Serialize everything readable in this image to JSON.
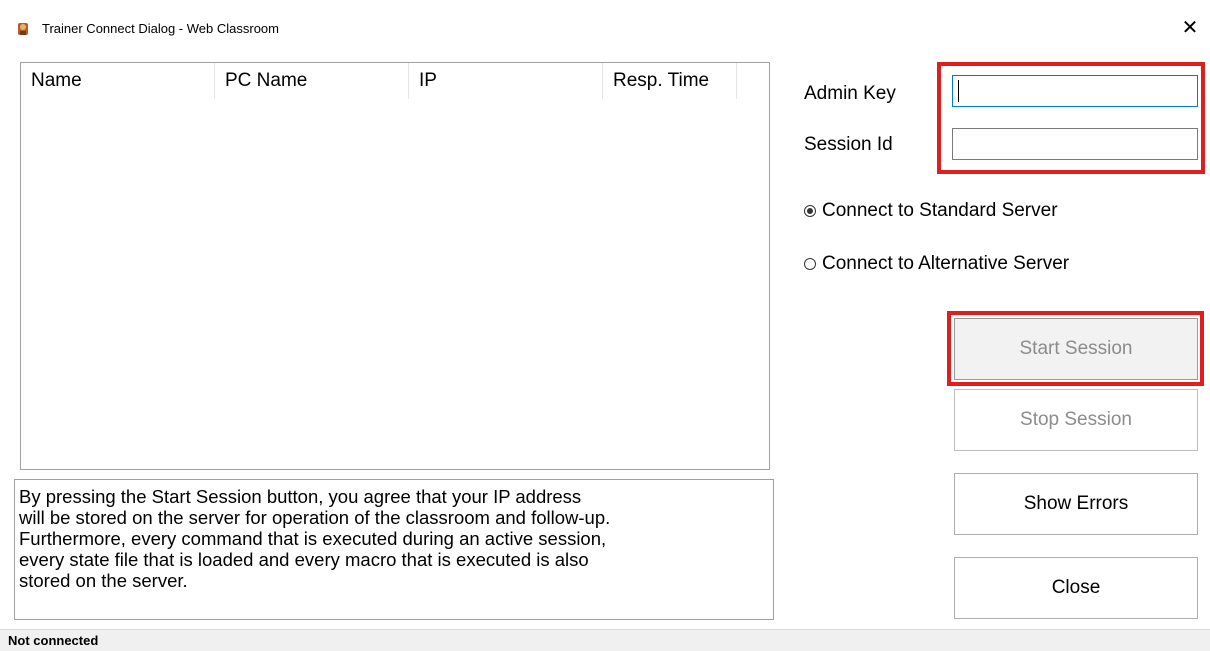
{
  "window": {
    "title": "Trainer Connect Dialog - Web Classroom",
    "close_glyph": "✕",
    "icon": "app-icon"
  },
  "listview": {
    "columns": [
      "Name",
      "PC Name",
      "IP",
      "Resp. Time"
    ],
    "rows": []
  },
  "info": {
    "lines": [
      "By pressing the Start Session button, you agree that your IP address",
      "will be stored on the server for operation of the classroom and follow-up.",
      "Furthermore, every command that is executed during an active session,",
      "every state file that is loaded and every macro that is executed is also",
      "stored on the server."
    ]
  },
  "form": {
    "admin_key_label": "Admin Key",
    "admin_key_value": "",
    "session_id_label": "Session Id",
    "session_id_value": ""
  },
  "radios": {
    "standard_label": "Connect to Standard Server",
    "standard_checked": true,
    "alternative_label": "Connect to Alternative Server",
    "alternative_checked": false
  },
  "buttons": {
    "start": "Start Session",
    "stop": "Stop Session",
    "errors": "Show Errors",
    "close": "Close"
  },
  "status": {
    "text": "Not connected"
  },
  "colors": {
    "highlight": "#e01e1e",
    "focus_border": "#0078d7"
  }
}
